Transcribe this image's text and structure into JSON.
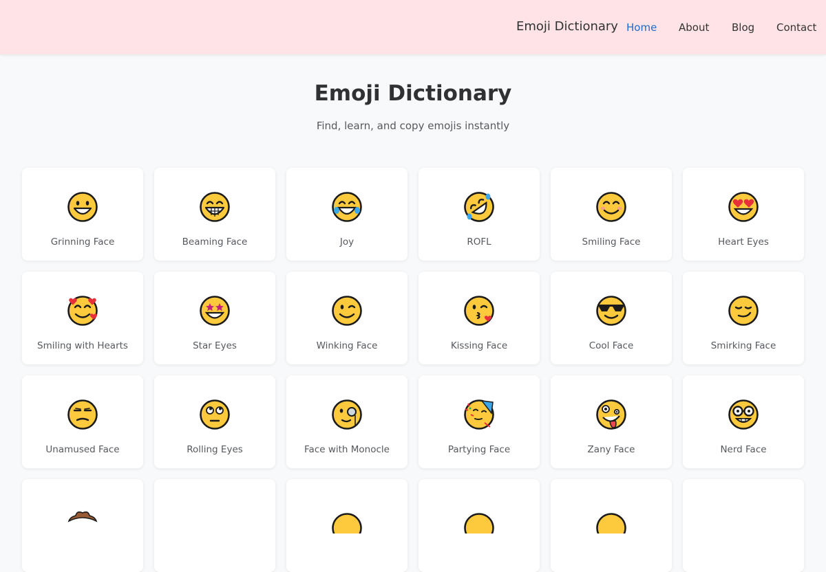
{
  "header": {
    "brand": "Emoji Dictionary",
    "nav": [
      {
        "label": "Home",
        "active": true
      },
      {
        "label": "About",
        "active": false
      },
      {
        "label": "Blog",
        "active": false
      },
      {
        "label": "Contact",
        "active": false
      }
    ]
  },
  "hero": {
    "title": "Emoji Dictionary",
    "subtitle": "Find, learn, and copy emojis instantly"
  },
  "emojis": [
    {
      "label": "Grinning Face",
      "icon": "grinning-face-icon"
    },
    {
      "label": "Beaming Face",
      "icon": "beaming-face-icon"
    },
    {
      "label": "Joy",
      "icon": "joy-face-icon"
    },
    {
      "label": "ROFL",
      "icon": "rofl-face-icon"
    },
    {
      "label": "Smiling Face",
      "icon": "smiling-face-icon"
    },
    {
      "label": "Heart Eyes",
      "icon": "heart-eyes-face-icon"
    },
    {
      "label": "Smiling with Hearts",
      "icon": "smiling-hearts-face-icon"
    },
    {
      "label": "Star Eyes",
      "icon": "star-eyes-face-icon"
    },
    {
      "label": "Winking Face",
      "icon": "winking-face-icon"
    },
    {
      "label": "Kissing Face",
      "icon": "kissing-face-icon"
    },
    {
      "label": "Cool Face",
      "icon": "cool-face-icon"
    },
    {
      "label": "Smirking Face",
      "icon": "smirking-face-icon"
    },
    {
      "label": "Unamused Face",
      "icon": "unamused-face-icon"
    },
    {
      "label": "Rolling Eyes",
      "icon": "rolling-eyes-face-icon"
    },
    {
      "label": "Face with Monocle",
      "icon": "monocle-face-icon"
    },
    {
      "label": "Partying Face",
      "icon": "partying-face-icon"
    },
    {
      "label": "Zany Face",
      "icon": "zany-face-icon"
    },
    {
      "label": "Nerd Face",
      "icon": "nerd-face-icon"
    },
    {
      "label": "",
      "icon": "cowboy-face-icon"
    },
    {
      "label": "",
      "icon": "blank-icon"
    },
    {
      "label": "",
      "icon": "face-icon"
    },
    {
      "label": "",
      "icon": "face-icon"
    },
    {
      "label": "",
      "icon": "face-icon"
    },
    {
      "label": "",
      "icon": "blank-icon"
    }
  ],
  "colors": {
    "header_bg": "#ffe3e6",
    "page_bg": "#f8f9fb",
    "nav_active": "#1e6bc8",
    "emoji_yellow": "#fcca3c"
  }
}
